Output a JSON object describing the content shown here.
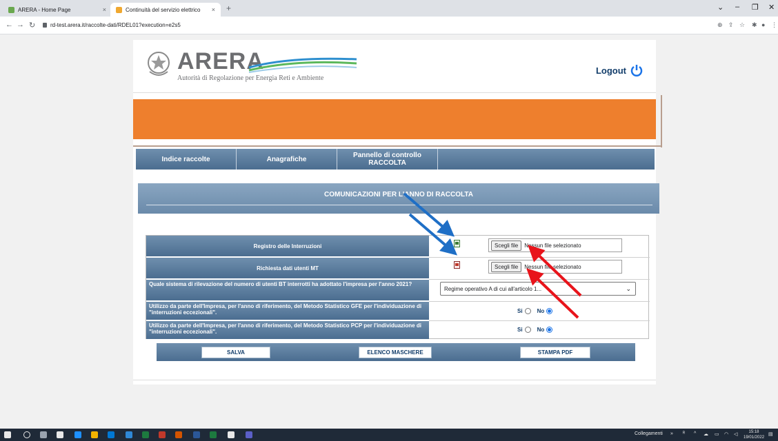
{
  "browser": {
    "tabs": [
      {
        "title": "ARERA - Home Page",
        "active": false
      },
      {
        "title": "Continuità del servizio elettrico",
        "active": true
      }
    ],
    "new_tab": "+",
    "close_glyph": "×",
    "url": "rd-test.arera.it/raccolte-dati/RDEL01?execution=e2s5"
  },
  "header": {
    "logo_title": "ARERA",
    "logo_subtitle": "Autorità di Regolazione per Energia Reti e Ambiente",
    "logout_label": "Logout"
  },
  "menu": {
    "items": [
      {
        "label": "Indice raccolte"
      },
      {
        "label": "Anagrafiche"
      },
      {
        "label": "Pannello di controllo RACCOLTA"
      }
    ]
  },
  "section": {
    "title": "COMUNICAZIONI PER L'ANNO DI RACCOLTA"
  },
  "form": {
    "rows": [
      {
        "label": "Registro delle Interruzioni",
        "file_button": "Scegli file",
        "file_status": "Nessun file selezionato"
      },
      {
        "label": "Richiesta dati utenti MT",
        "file_button": "Scegli file",
        "file_status": "Nessun file selezionato"
      },
      {
        "label": "Quale sistema di rilevazione del numero di utenti BT interrotti ha adottato l'impresa per l'anno 2021?",
        "select_value": "Regime operativo A di cui all'articolo 1..."
      },
      {
        "label": "Utilizzo da parte dell'Impresa, per l'anno di riferimento, del Metodo Statistico GFE per l'individuazione di \"interruzioni eccezionali\".",
        "yes_label": "Si",
        "no_label": "No",
        "selected": "No"
      },
      {
        "label": "Utilizzo da parte dell'Impresa, per l'anno di riferimento, del Metodo Statistico PCP per l'individuazione di \"interruzioni eccezionali\".",
        "yes_label": "Si",
        "no_label": "No",
        "selected": "No"
      }
    ]
  },
  "actions": {
    "save": "SALVA",
    "list": "ELENCO MASCHERE",
    "pdf": "STAMPA PDF"
  },
  "taskbar": {
    "network": "Collegamenti",
    "time": "15:18",
    "date": "19/01/2022"
  },
  "colors": {
    "orange_band": "#ee7f2d",
    "menu_blue": "#5a7b9c",
    "annotation_blue": "#1f6fc6",
    "annotation_red": "#e8141b"
  }
}
